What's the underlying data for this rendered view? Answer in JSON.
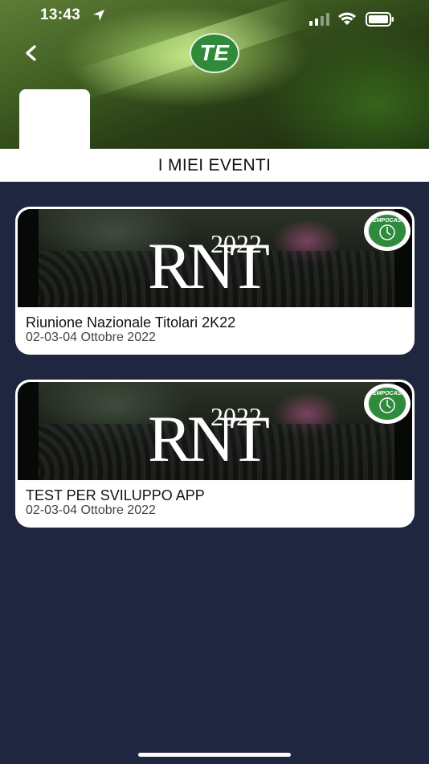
{
  "status_bar": {
    "time": "13:43",
    "icons": [
      "location-arrow-icon",
      "signal-icon",
      "wifi-icon",
      "battery-icon"
    ]
  },
  "header": {
    "logo_text": "TE",
    "back_icon": "chevron-left-icon",
    "accent_color": "#2f8a3a"
  },
  "section": {
    "title": "I MIEI EVENTI"
  },
  "events": [
    {
      "title": "Riunione Nazionale Titolari 2K22",
      "date": "02-03-04 Ottobre 2022",
      "image_logo": "RNT",
      "image_year": "2022",
      "badge_text": "TEMPOCASA"
    },
    {
      "title": "TEST PER SVILUPPO APP",
      "date": "02-03-04 Ottobre 2022",
      "image_logo": "RNT",
      "image_year": "2022",
      "badge_text": "TEMPOCASA"
    }
  ],
  "colors": {
    "background": "#1f2640",
    "card": "#ffffff",
    "brand_green": "#2e8b3c"
  }
}
